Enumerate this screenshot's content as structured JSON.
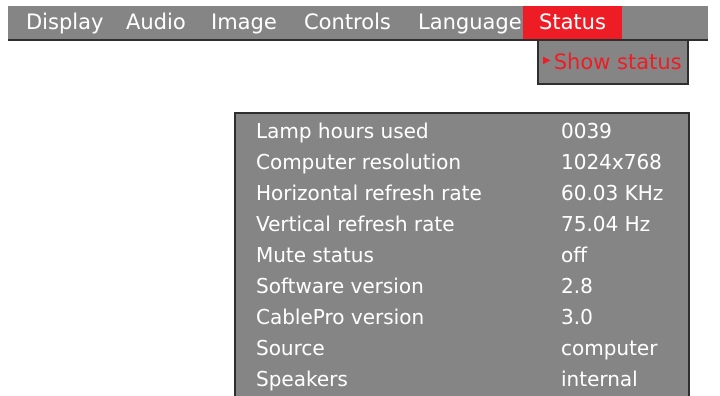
{
  "menu": {
    "tabs": [
      {
        "label": "Display"
      },
      {
        "label": "Audio"
      },
      {
        "label": "Image"
      },
      {
        "label": "Controls"
      },
      {
        "label": "Language"
      },
      {
        "label": "Status"
      }
    ],
    "active_tab": "Status"
  },
  "submenu": {
    "item_label": "Show status",
    "arrow_icon": "right-triangle-icon"
  },
  "status": {
    "rows": [
      {
        "label": "Lamp hours used",
        "value": "0039"
      },
      {
        "label": "Computer resolution",
        "value": "1024x768"
      },
      {
        "label": "Horizontal refresh rate",
        "value": "60.03 KHz"
      },
      {
        "label": "Vertical refresh rate",
        "value": "75.04 Hz"
      },
      {
        "label": "Mute status",
        "value": "off"
      },
      {
        "label": "Software version",
        "value": "2.8"
      },
      {
        "label": "CablePro version",
        "value": "3.0"
      },
      {
        "label": "Source",
        "value": "computer"
      },
      {
        "label": "Speakers",
        "value": "internal"
      }
    ]
  },
  "colors": {
    "menu_background": "#858585",
    "active_tab": "#ee1c25",
    "highlight_text": "#ee1c25",
    "text": "#ffffff",
    "border": "#2e2e2e"
  }
}
